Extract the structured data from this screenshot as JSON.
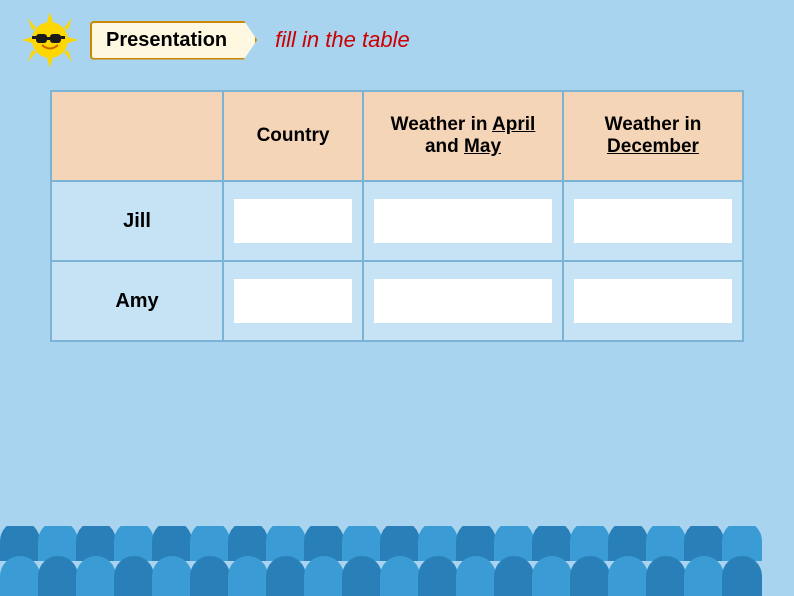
{
  "header": {
    "badge_label": "Presentation",
    "subtitle": "fill in the table",
    "sun_emoji": "😎"
  },
  "table": {
    "columns": [
      {
        "id": "name",
        "label": ""
      },
      {
        "id": "country",
        "label": "Country"
      },
      {
        "id": "april_may",
        "label": "Weather in April and May",
        "underline_words": [
          "April",
          "May"
        ]
      },
      {
        "id": "december",
        "label": "Weather in December",
        "underline_words": [
          "December"
        ]
      }
    ],
    "rows": [
      {
        "name": "Jill",
        "country_placeholder": "",
        "april_may_placeholder": "",
        "december_placeholder": ""
      },
      {
        "name": "Amy",
        "country_placeholder": "",
        "april_may_placeholder": "",
        "december_placeholder": ""
      }
    ]
  },
  "colors": {
    "background": "#a8d4f0",
    "header_cell": "#f5d5b8",
    "data_cell": "#c5e3f5",
    "input_bg": "#ffffff",
    "wave_dark": "#2980b9",
    "wave_light": "#3a9bd5",
    "subtitle_color": "#cc0000"
  }
}
